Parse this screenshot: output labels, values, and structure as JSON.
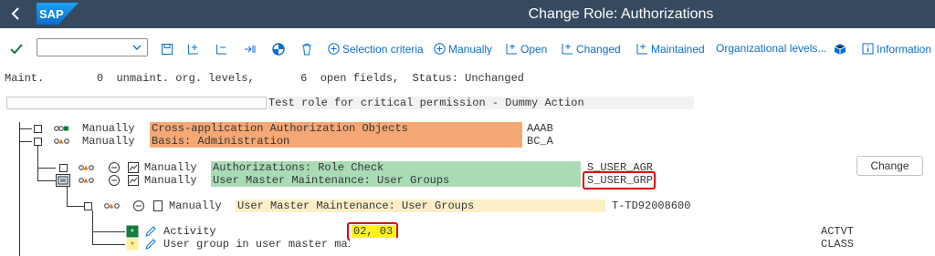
{
  "window": {
    "title": "Change Role: Authorizations",
    "logo_text": "SAP"
  },
  "toolbar": {
    "okcode_value": "",
    "selection_criteria": "Selection criteria",
    "manually": "Manually",
    "open": "Open",
    "changed": "Changed",
    "maintained": "Maintained",
    "org_levels": "Organizational levels...",
    "information": "Information"
  },
  "status_line": {
    "maint_label": "Maint.",
    "unmaint_count": "0",
    "unmaint_label": "unmaint. org. levels,",
    "open_count": "6",
    "open_label": "open fields,",
    "status_label": "Status:",
    "status_value": "Unchanged"
  },
  "role": {
    "description": "Test role for critical permission - Dummy Action"
  },
  "tree": {
    "n1": {
      "status": "Manually",
      "text": "Cross-application Authorization Objects",
      "code": "AAAB"
    },
    "n2": {
      "status": "Manually",
      "text": "Basis: Administration",
      "code": "BC_A"
    },
    "n3": {
      "status": "Manually",
      "text": "Authorizations: Role Check",
      "code": "S_USER_AGR"
    },
    "n4": {
      "status": "Manually",
      "text": "User Master Maintenance: User Groups",
      "code": "S_USER_GRP"
    },
    "n5": {
      "status": "Manually",
      "text": "User Master Maintenance: User Groups",
      "code": "T-TD92008600"
    },
    "f1": {
      "label": "Activity",
      "value": "02, 03",
      "field": "ACTVT"
    },
    "f2": {
      "label": "User group in user master main",
      "value": "",
      "field": "CLASS"
    }
  },
  "buttons": {
    "change": "Change"
  },
  "colors": {
    "titlebar": "#354a5f",
    "accent": "#0a6ed1",
    "orange_bar": "#f5a873",
    "green_bar": "#a9dbb5",
    "yellow_bar": "#fcefc7",
    "highlight_yellow": "#fff21e",
    "red_frame": "#e00000"
  },
  "icons": [
    "back-arrow-icon",
    "check-icon",
    "save-icon",
    "plus-icon",
    "folder-open-icon",
    "trash-icon",
    "info-icon"
  ]
}
